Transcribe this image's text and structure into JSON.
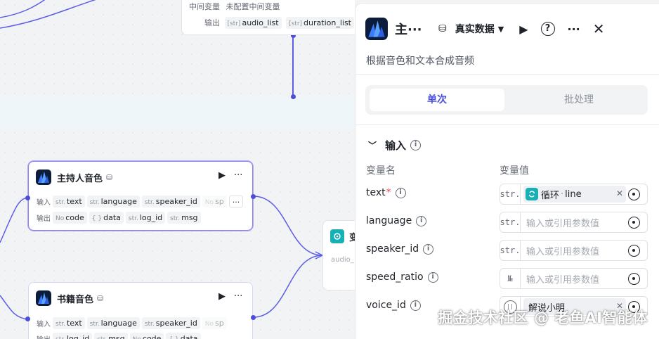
{
  "canvas": {
    "top_node": {
      "intermediate_label": "中间变量",
      "intermediate_value": "未配置中间变量",
      "output_label": "输出",
      "outputs": [
        {
          "type": "[str]",
          "name": "audio_list"
        },
        {
          "type": "[str]",
          "name": "duration_list"
        }
      ]
    },
    "host_node": {
      "title": "主持人音色",
      "input_label": "输入",
      "output_label": "输出",
      "inputs": [
        {
          "type": "str.",
          "name": "text"
        },
        {
          "type": "str.",
          "name": "language"
        },
        {
          "type": "str.",
          "name": "speaker_id"
        },
        {
          "type": "No",
          "name": "sp"
        }
      ],
      "more": "···",
      "outputs": [
        {
          "type": "No",
          "name": "code"
        },
        {
          "type": "{ }",
          "name": "data"
        },
        {
          "type": "str.",
          "name": "log_id"
        },
        {
          "type": "str.",
          "name": "msg"
        }
      ]
    },
    "book_node": {
      "title": "书籍音色",
      "input_label": "输入",
      "output_label": "输出",
      "inputs": [
        {
          "type": "str.",
          "name": "text"
        },
        {
          "type": "str.",
          "name": "language"
        },
        {
          "type": "str.",
          "name": "speaker_id"
        },
        {
          "type": "No",
          "name": "sp"
        }
      ],
      "outputs": [
        {
          "type": "str.",
          "name": "log_id"
        },
        {
          "type": "str.",
          "name": "msg"
        },
        {
          "type": "No",
          "name": "code"
        },
        {
          "type": "{ }",
          "name": "data"
        }
      ]
    },
    "mid_node": {
      "title": "变",
      "sub": "audio_"
    }
  },
  "panel": {
    "title": "主···",
    "data_source": "真实数据",
    "description": "根据音色和文本合成音频",
    "tabs": {
      "single": "单次",
      "batch": "批处理"
    },
    "section_title": "输入",
    "col_name": "变量名",
    "col_value": "变量值",
    "params": [
      {
        "name": "text",
        "required": true,
        "type": "str.",
        "ref_node": "循环",
        "ref_var": "line"
      },
      {
        "name": "language",
        "required": false,
        "type": "str.",
        "placeholder": "输入或引用参数值"
      },
      {
        "name": "speaker_id",
        "required": false,
        "type": "str.",
        "placeholder": "输入或引用参数值"
      },
      {
        "name": "speed_ratio",
        "required": false,
        "type": "№",
        "placeholder": "输入或引用参数值"
      },
      {
        "name": "voice_id",
        "required": false,
        "type": "((·))",
        "value": "解说小明"
      }
    ]
  },
  "watermark": "掘金技术社区 @ 老鱼AI智能体",
  "colors": {
    "accent": "#4c4ed9",
    "teal": "#16b0b6",
    "logo_bg": "#0c1d3c"
  }
}
